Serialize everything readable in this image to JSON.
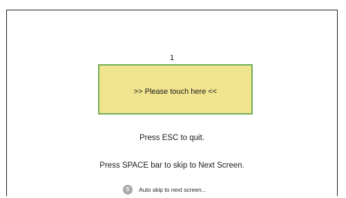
{
  "screen": {
    "counter": "1",
    "touch_target_label": ">> Please touch here <<",
    "instructions": {
      "esc": "Press ESC to quit.",
      "space": "Press SPACE bar to skip to Next Screen."
    },
    "auto_skip": {
      "countdown": "5",
      "label": "Auto skip to next screen..."
    }
  },
  "colors": {
    "touch_target_fill": "#f0e48f",
    "touch_target_border": "#6fae56",
    "countdown_badge": "#a9a9a9"
  }
}
